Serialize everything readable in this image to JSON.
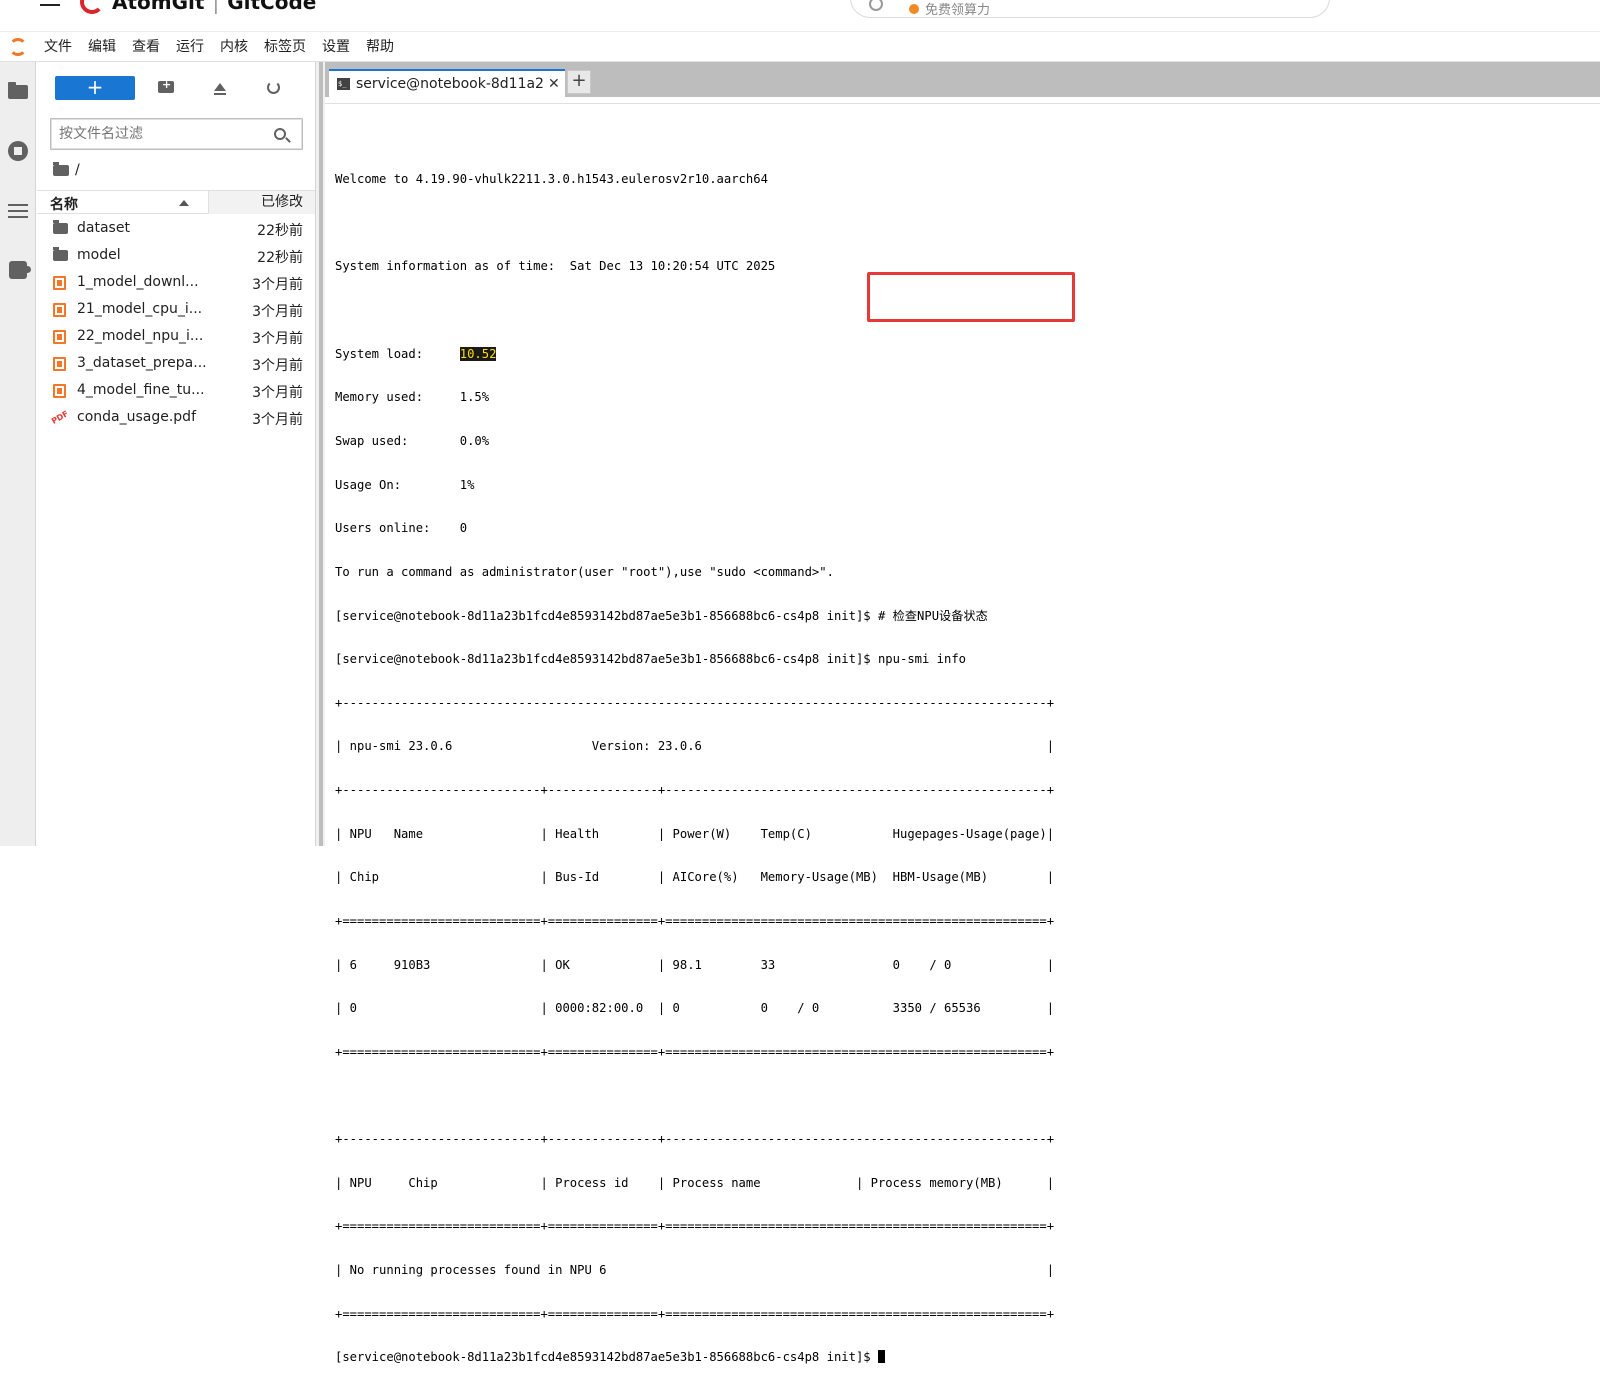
{
  "site": {
    "brand_name": "AtomGit",
    "brand_sep": "|",
    "brand_name2": "GitCode",
    "search_promo": "免费领算力"
  },
  "menubar": {
    "items": [
      "文件",
      "编辑",
      "查看",
      "运行",
      "内核",
      "标签页",
      "设置",
      "帮助"
    ]
  },
  "filebrowser": {
    "new_label": "+",
    "filter_placeholder": "按文件名过滤",
    "path": "/",
    "header_name": "名称",
    "header_modified": "已修改",
    "files": [
      {
        "name": "dataset",
        "modified": "22秒前",
        "type": "folder"
      },
      {
        "name": "model",
        "modified": "22秒前",
        "type": "folder"
      },
      {
        "name": "1_model_downl...",
        "modified": "3个月前",
        "type": "notebook"
      },
      {
        "name": "21_model_cpu_i...",
        "modified": "3个月前",
        "type": "notebook"
      },
      {
        "name": "22_model_npu_i...",
        "modified": "3个月前",
        "type": "notebook"
      },
      {
        "name": "3_dataset_prepa...",
        "modified": "3个月前",
        "type": "notebook"
      },
      {
        "name": "4_model_fine_tu...",
        "modified": "3个月前",
        "type": "notebook"
      },
      {
        "name": "conda_usage.pdf",
        "modified": "3个月前",
        "type": "pdf"
      }
    ]
  },
  "tabs": {
    "active_label": "service@notebook-8d11a2",
    "close_glyph": "✕",
    "add_glyph": "+"
  },
  "terminal": {
    "welcome": "Welcome to 4.19.90-vhulk2211.3.0.h1543.eulerosv2r10.aarch64",
    "sysinfo": "System information as of time:  Sat Dec 13 10:20:54 UTC 2025",
    "load_label": "System load:     ",
    "load_value": "10.52",
    "memory": "Memory used:     1.5%",
    "swap": "Swap used:       0.0%",
    "usage": "Usage On:        1%",
    "users": "Users online:    0",
    "admin_hint": "To run a command as administrator(user \"root\"),use \"sudo <command>\".",
    "cmd1": "[service@notebook-8d11a23b1fcd4e8593142bd87ae5e3b1-856688bc6-cs4p8 init]$ # 检查NPU设备状态",
    "cmd2": "[service@notebook-8d11a23b1fcd4e8593142bd87ae5e3b1-856688bc6-cs4p8 init]$ npu-smi info",
    "t01": "+------------------------------------------------------------------------------------------------+",
    "t02": "| npu-smi 23.0.6                   Version: 23.0.6                                               |",
    "t03": "+---------------------------+---------------+----------------------------------------------------+",
    "t04": "| NPU   Name                | Health        | Power(W)    Temp(C)           Hugepages-Usage(page)|",
    "t05": "| Chip                      | Bus-Id        | AICore(%)   Memory-Usage(MB)  HBM-Usage(MB)        |",
    "t06": "+===========================+===============+====================================================+",
    "t07": "| 6     910B3               | OK            | 98.1        33                0    / 0             |",
    "t08": "| 0                         | 0000:82:00.0  | 0           0    / 0          3350 / 65536         |",
    "t09": "+===========================+===============+====================================================+",
    "t10": "+---------------------------+---------------+----------------------------------------------------+",
    "t11": "| NPU     Chip              | Process id    | Process name             | Process memory(MB)      |",
    "t12": "+===========================+===============+====================================================+",
    "t13": "| No running processes found in NPU 6                                                            |",
    "t14": "+===========================+===============+====================================================+",
    "prompt": "[service@notebook-8d11a23b1fcd4e8593142bd87ae5e3b1-856688bc6-cs4p8 init]$ "
  },
  "colors": {
    "accent": "#1976d2",
    "annotation": "#e53935",
    "notebook_icon": "#f37726"
  }
}
